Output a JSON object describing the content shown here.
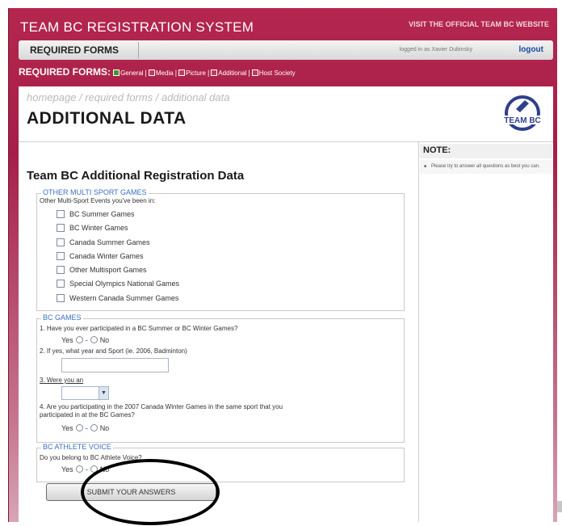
{
  "header": {
    "system_title": "TEAM BC REGISTRATION SYSTEM",
    "visit_link": "VISIT THE OFFICIAL TEAM BC WEBSITE"
  },
  "required_bar": {
    "label": "REQUIRED FORMS",
    "login_text": "logged in as Xavier Dubinsky",
    "logout": "logout"
  },
  "forms_nav": {
    "label": "REQUIRED FORMS",
    "links": [
      "General",
      "Media",
      "Picture",
      "Additional",
      "Host Society"
    ],
    "separator": "|"
  },
  "breadcrumb": "homepage / required forms / additional data",
  "page_title": "ADDITIONAL DATA",
  "logo_text": "TEAM BC",
  "note": {
    "title": "NOTE:",
    "text": "Please try to answer all questions as best you can."
  },
  "form_title": "Team BC Additional Registration Data",
  "multi_sport": {
    "legend": "OTHER MULTI SPORT GAMES",
    "prompt": "Other Multi-Sport Events you've been in:",
    "options": [
      "BC Summer Games",
      "BC Winter Games",
      "Canada Summer Games",
      "Canada Winter Games",
      "Other Multisport Games",
      "Special Olympics National Games",
      "Western Canada Summer Games"
    ]
  },
  "bc_games": {
    "legend": "BC GAMES",
    "q1": "1. Have you ever participated in a BC Summer or BC Winter Games?",
    "q2": "2. If yes, what year and Sport (ie. 2006, Badminton)",
    "q3": "3. Were you an",
    "q4_line1": "4. Are you participating in the 2007 Canada Winter Games in the same sport that you",
    "q4_line2": "participated in at the BC Games?"
  },
  "athlete_voice": {
    "legend": "BC ATHLETE VOICE",
    "q1": "Do you belong to BC Athlete Voice?"
  },
  "yes_label": "Yes",
  "no_label": "No",
  "dash": "-",
  "submit_label": "SUBMIT YOUR ANSWERS"
}
